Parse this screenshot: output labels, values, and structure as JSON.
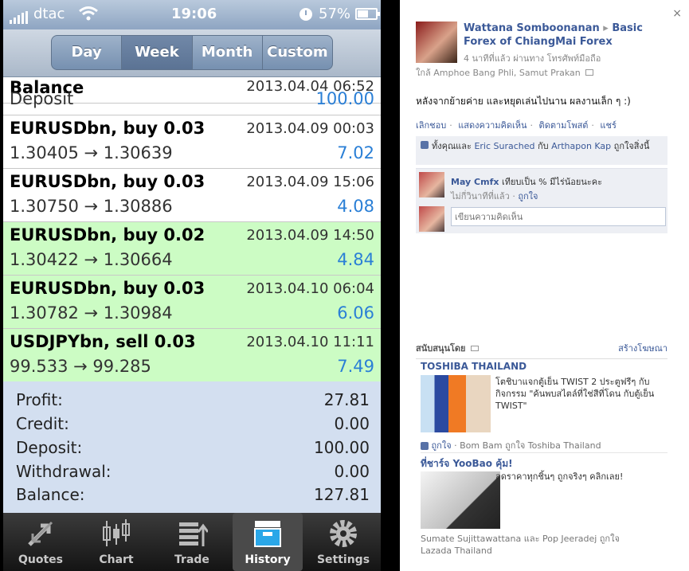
{
  "status_bar": {
    "carrier": "dtac",
    "time": "19:06",
    "battery": "57%",
    "battery_level": 0.57
  },
  "segments": [
    {
      "label": "Day",
      "active": false
    },
    {
      "label": "Week",
      "active": true
    },
    {
      "label": "Month",
      "active": false
    },
    {
      "label": "Custom",
      "active": false
    }
  ],
  "history": {
    "partial_row": {
      "title": "Balance",
      "date": "2013.04.04 06:52"
    },
    "deposit_row": {
      "label": "Deposit",
      "value": "100.00"
    },
    "trades": [
      {
        "title": "EURUSDbn, buy 0.03",
        "date": "2013.04.09 00:03",
        "prices": "1.30405 → 1.30639",
        "profit": "7.02",
        "highlight": false
      },
      {
        "title": "EURUSDbn, buy 0.03",
        "date": "2013.04.09 15:06",
        "prices": "1.30750 → 1.30886",
        "profit": "4.08",
        "highlight": false
      },
      {
        "title": "EURUSDbn, buy 0.02",
        "date": "2013.04.09 14:50",
        "prices": "1.30422 → 1.30664",
        "profit": "4.84",
        "highlight": true
      },
      {
        "title": "EURUSDbn, buy 0.03",
        "date": "2013.04.10 06:04",
        "prices": "1.30782 → 1.30984",
        "profit": "6.06",
        "highlight": true
      },
      {
        "title": "USDJPYbn, sell 0.03",
        "date": "2013.04.10 11:11",
        "prices": "99.533 → 99.285",
        "profit": "7.49",
        "highlight": true
      }
    ]
  },
  "summary": [
    {
      "label": "Profit:",
      "value": "27.81"
    },
    {
      "label": "Credit:",
      "value": "0.00"
    },
    {
      "label": "Deposit:",
      "value": "100.00"
    },
    {
      "label": "Withdrawal:",
      "value": "0.00"
    },
    {
      "label": "Balance:",
      "value": "127.81"
    }
  ],
  "tabs": [
    {
      "label": "Quotes",
      "icon": "quotes-icon"
    },
    {
      "label": "Chart",
      "icon": "chart-icon"
    },
    {
      "label": "Trade",
      "icon": "trade-icon"
    },
    {
      "label": "History",
      "icon": "history-icon",
      "active": true
    },
    {
      "label": "Settings",
      "icon": "settings-icon"
    }
  ],
  "facebook": {
    "close_label": "×",
    "author": "Wattana Somboonanan",
    "arrow": "▸",
    "group": "Basic Forex of ChiangMai Forex",
    "meta": "4 นาทีที่แล้ว ผ่านทาง โทรศัพท์มือถือ",
    "location": "ใกล้ Amphoe Bang Phli, Samut Prakan",
    "post_text": "หลังจากย้ายค่าย และหยุดเล่นไปนาน ผลงานเล็ก ๆ :)",
    "actions": [
      "เลิกชอบ",
      "แสดงความคิดเห็น",
      "ติดตามโพสต์",
      "แชร์"
    ],
    "likes": {
      "prefix": "ทั้งคุณและ",
      "person1": "Eric Surached",
      "mid": "กับ",
      "person2": "Arthapon Kap",
      "suffix": "ถูกใจสิ่งนี้"
    },
    "comment": {
      "name": "May Cmfx",
      "text": "เทียบเป็น % มีไร่น้อยนะคะ",
      "time": "ไม่กี่วินาทีที่แล้ว",
      "like": "ถูกใจ"
    },
    "comment_placeholder": "เขียนความคิดเห็น",
    "sponsored": "สนับสนุนโดย",
    "create_ad": "สร้างโฆษณา",
    "ads": [
      {
        "title": "TOSHIBA THAILAND",
        "text": "โตชิบาแจกตู้เย็น TWIST 2 ประตูฟรีๆ กับกิจกรรม \"ค้นพบสไตล์ที่ใช่สีที่โดน กับตู้เย็น TWIST\"",
        "like": "ถูกใจ",
        "social": "· Bom Bam ถูกใจ Toshiba Thailand"
      },
      {
        "title": "ที่ชาร์จ YooBao คุ้ม!",
        "text": "ลดราคาทุกชิ้นๆ ถูกจริงๆ คลิกเลย!",
        "social": "Sumate Sujittawattana และ Pop Jeeradej ถูกใจ Lazada Thailand"
      }
    ]
  }
}
